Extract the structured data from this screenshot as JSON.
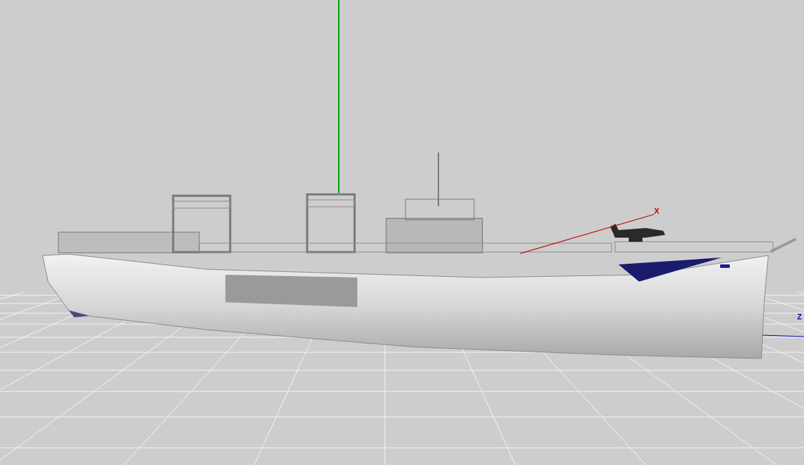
{
  "viewport": {
    "axes": [
      {
        "kind": "x",
        "label": "X",
        "color": "#c00000"
      },
      {
        "kind": "y",
        "color": "#00a000"
      },
      {
        "kind": "z",
        "label": "Z",
        "color": "#0000c0"
      }
    ]
  }
}
